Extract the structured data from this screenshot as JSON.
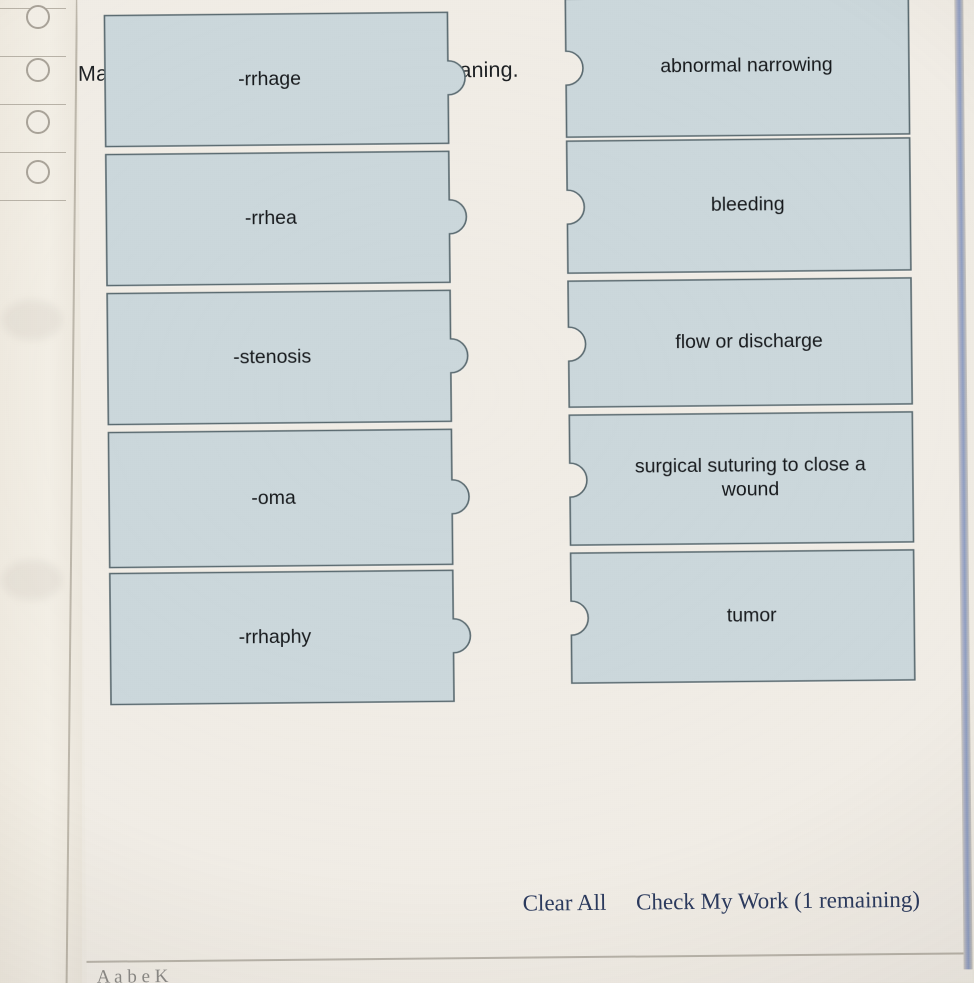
{
  "question": {
    "prompt": "Match the word part with the correct meaning."
  },
  "board": {
    "terms": [
      {
        "label": "-rrhage"
      },
      {
        "label": "-rrhea"
      },
      {
        "label": "-stenosis"
      },
      {
        "label": "-oma"
      },
      {
        "label": "-rrhaphy"
      }
    ],
    "definitions": [
      {
        "label": "abnormal narrowing"
      },
      {
        "label": "bleeding"
      },
      {
        "label": "flow or discharge"
      },
      {
        "label": "surgical suturing to close a wound"
      },
      {
        "label": "tumor"
      }
    ]
  },
  "footer": {
    "clear_all_label": "Clear All",
    "check_my_work_label": "Check My Work (1 remaining)"
  },
  "below_divider_text": "A a b e K",
  "colors": {
    "piece_fill": "#ccd8dc",
    "piece_border": "#5a6a70",
    "page_background": "#f1ede6",
    "footer_link": "#2b3a5e",
    "text": "#16191c"
  }
}
